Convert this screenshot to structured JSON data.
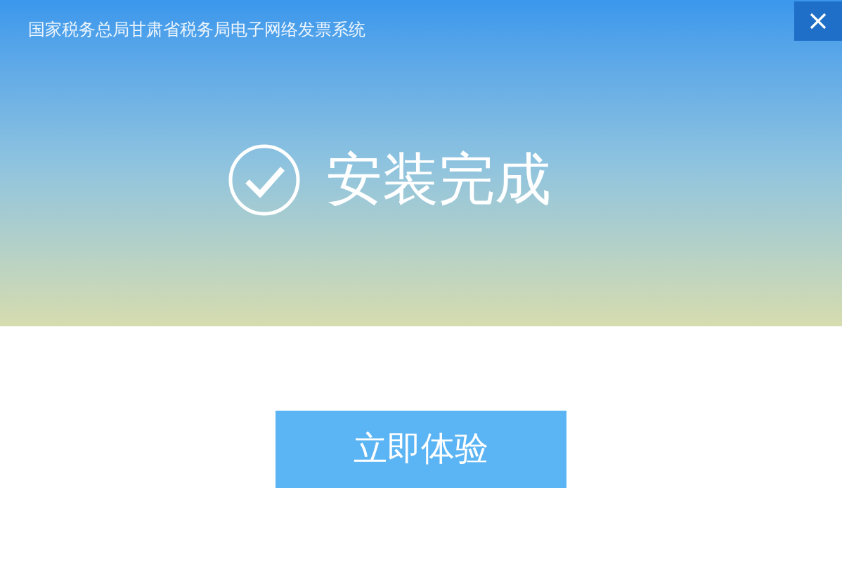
{
  "window": {
    "title": "国家税务总局甘肃省税务局电子网络发票系统"
  },
  "status": {
    "heading": "安装完成"
  },
  "buttons": [
    {
      "label": "立即体验"
    }
  ]
}
